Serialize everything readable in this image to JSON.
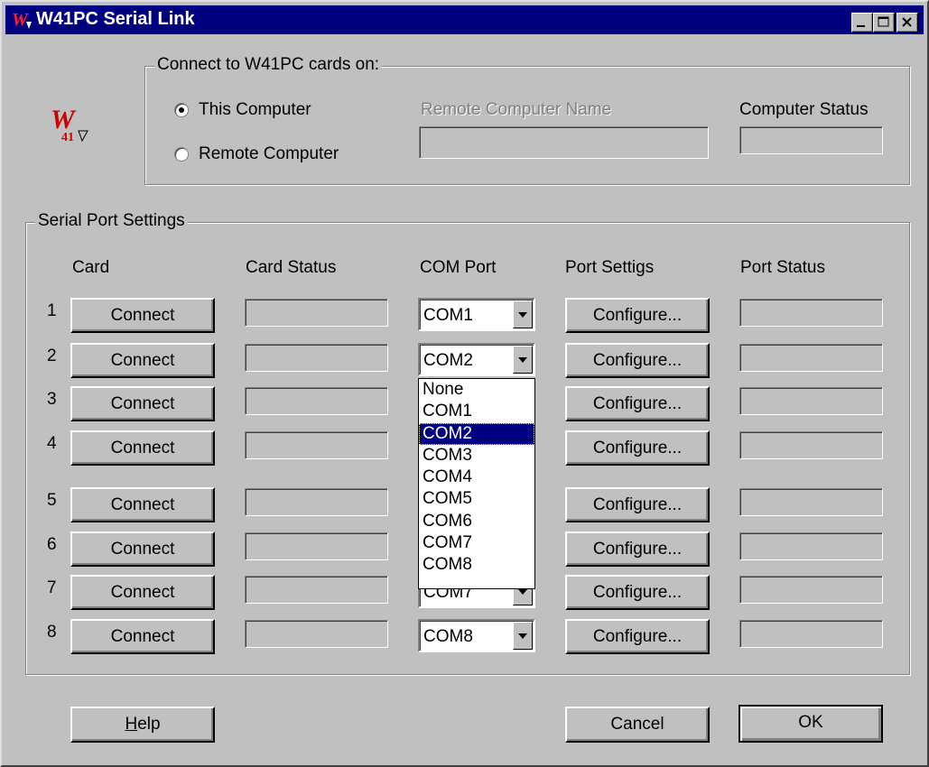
{
  "window": {
    "title": "W41PC Serial Link"
  },
  "connect_group": {
    "legend": "Connect to W41PC cards on:",
    "this_computer_label": "This Computer",
    "remote_computer_label": "Remote Computer",
    "remote_name_label": "Remote Computer Name",
    "computer_status_label": "Computer Status",
    "selected": "This Computer"
  },
  "serial_group": {
    "legend": "Serial Port Settings",
    "headers": {
      "card": "Card",
      "card_status": "Card Status",
      "com_port": "COM Port",
      "port_settings": "Port Settigs",
      "port_status": "Port Status"
    },
    "rows": [
      {
        "num": "1",
        "connect": "Connect",
        "com": "COM1",
        "configure": "Configure..."
      },
      {
        "num": "2",
        "connect": "Connect",
        "com": "COM2",
        "configure": "Configure..."
      },
      {
        "num": "3",
        "connect": "Connect",
        "com": "",
        "configure": "Configure..."
      },
      {
        "num": "4",
        "connect": "Connect",
        "com": "",
        "configure": "Configure..."
      },
      {
        "num": "5",
        "connect": "Connect",
        "com": "",
        "configure": "Configure..."
      },
      {
        "num": "6",
        "connect": "Connect",
        "com": "",
        "configure": "Configure..."
      },
      {
        "num": "7",
        "connect": "Connect",
        "com": "COM7",
        "configure": "Configure..."
      },
      {
        "num": "8",
        "connect": "Connect",
        "com": "COM8",
        "configure": "Configure..."
      }
    ]
  },
  "dropdown": {
    "options": [
      "None",
      "COM1",
      "COM2",
      "COM3",
      "COM4",
      "COM5",
      "COM6",
      "COM7",
      "COM8"
    ],
    "selected": "COM2"
  },
  "buttons": {
    "help": "Help",
    "cancel": "Cancel",
    "ok": "OK"
  },
  "colors": {
    "face": "#c0c0c0",
    "titlebar": "#000080",
    "highlight": "#000080"
  },
  "logo": {
    "text": "W",
    "subtext": "41"
  }
}
